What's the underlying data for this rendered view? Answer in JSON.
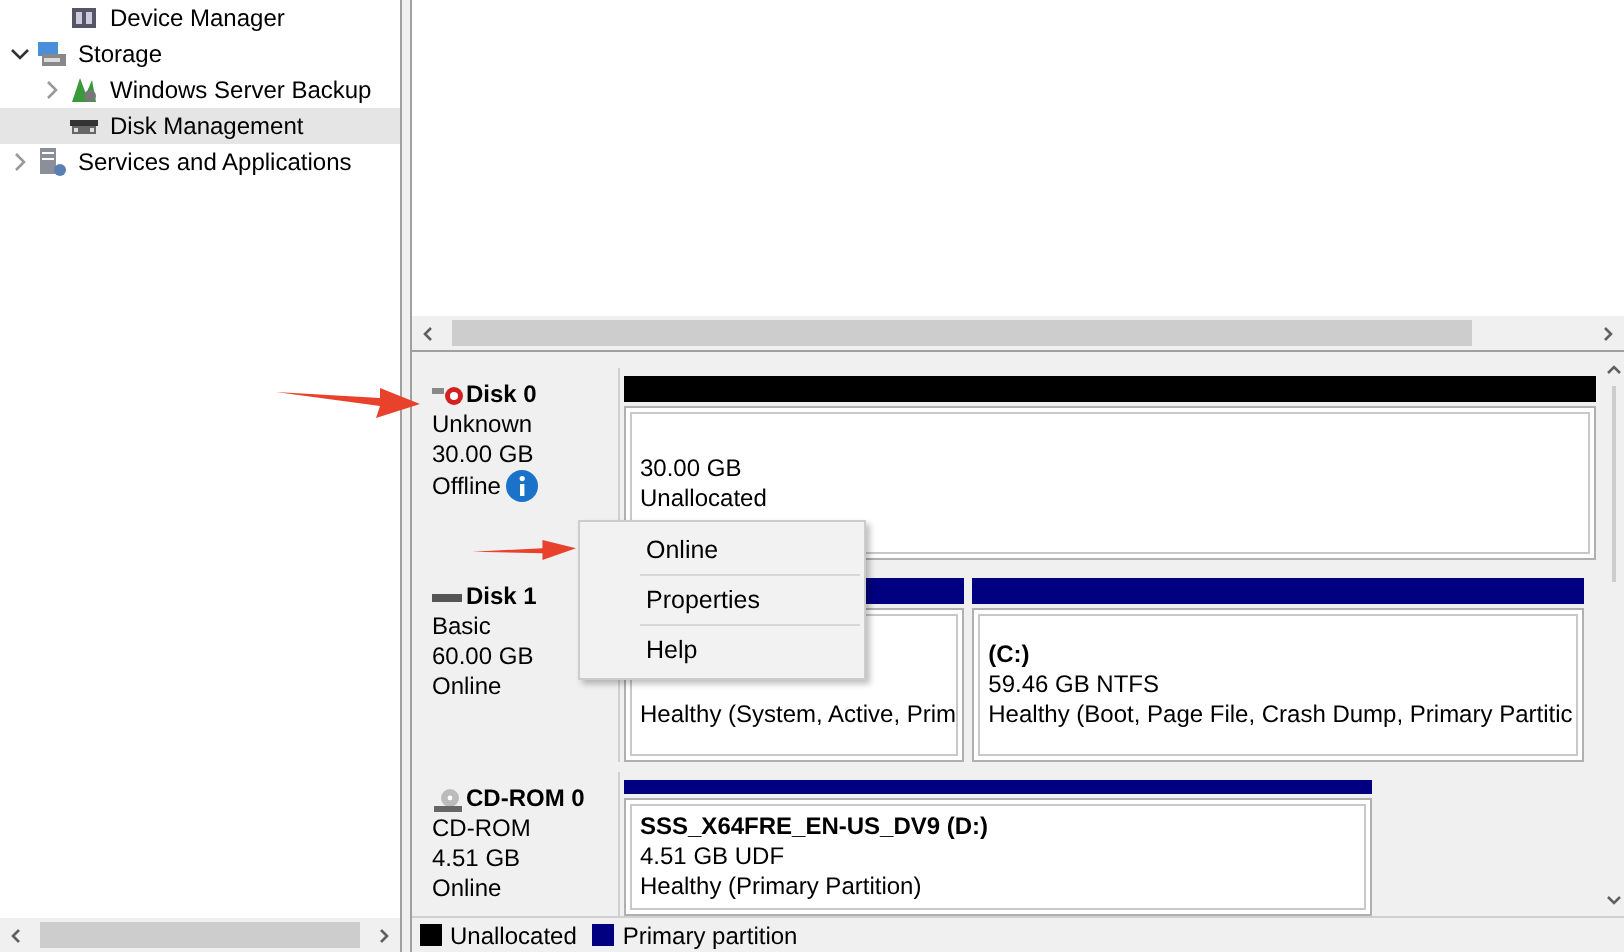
{
  "tree": {
    "items": [
      {
        "children": [
          {
            "label": "Device Manager",
            "kind": "device"
          }
        ]
      },
      {
        "label": "Storage",
        "kind": "storage",
        "expanded": true,
        "selected": false,
        "children": [
          {
            "label": "Windows Server Backup",
            "kind": "backup",
            "expanded": false,
            "selected": false
          },
          {
            "label": "Disk Management",
            "kind": "disk",
            "selected": true
          }
        ]
      },
      {
        "label": "Services and Applications",
        "kind": "services",
        "expanded": false,
        "selected": false
      }
    ]
  },
  "disks": [
    {
      "name": "Disk 0",
      "kind": "disk",
      "offline": true,
      "type": "Unknown",
      "size": "30.00 GB",
      "status": "Offline",
      "partitions": [
        {
          "kind": "unallocated",
          "lines": [
            "30.00 GB",
            "Unallocated"
          ]
        }
      ]
    },
    {
      "name": "Disk 1",
      "kind": "disk",
      "offline": false,
      "type": "Basic",
      "size": "60.00 GB",
      "status": "Online",
      "partitions": [
        {
          "kind": "primary",
          "lines": [
            "Healthy (System, Active, Prim"
          ]
        },
        {
          "kind": "primary",
          "title": "(C:)",
          "lines": [
            "59.46 GB NTFS",
            "Healthy (Boot, Page File, Crash Dump, Primary Partitic"
          ]
        }
      ]
    },
    {
      "name": "CD-ROM 0",
      "kind": "cdrom",
      "offline": false,
      "type": "CD-ROM",
      "size": "4.51 GB",
      "status": "Online",
      "partitions": [
        {
          "kind": "primary",
          "title": "SSS_X64FRE_EN-US_DV9  (D:)",
          "lines": [
            "4.51 GB UDF",
            "Healthy (Primary Partition)"
          ]
        }
      ]
    }
  ],
  "context_menu": {
    "items": [
      "Online",
      "Properties",
      "Help"
    ]
  },
  "legend": [
    {
      "label": "Unallocated",
      "color": "#000000"
    },
    {
      "label": "Primary partition",
      "color": "#000080"
    }
  ]
}
